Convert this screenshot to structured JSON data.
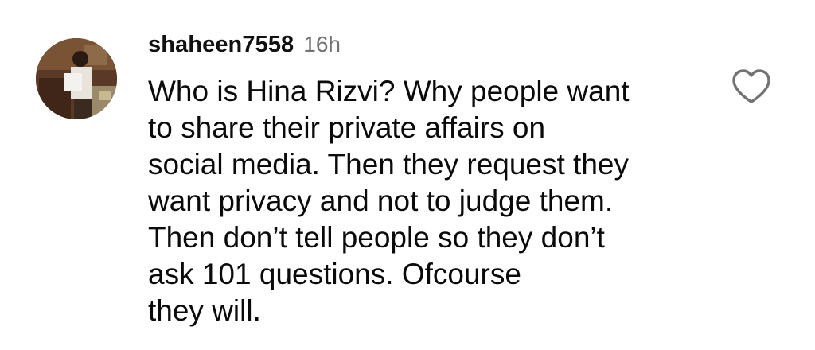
{
  "comment": {
    "username": "shaheen7558",
    "time": "16h",
    "avatar_icon": "profile-photo",
    "like_icon": "heart-outline-icon",
    "lines": [
      "Who is Hina Rizvi? Why people want",
      "to share their private affairs on",
      "social media. Then they request they",
      "want privacy and not to judge them.",
      "Then don’t tell people so they don’t",
      "ask 101 questions. Ofcourse",
      "they will."
    ]
  }
}
